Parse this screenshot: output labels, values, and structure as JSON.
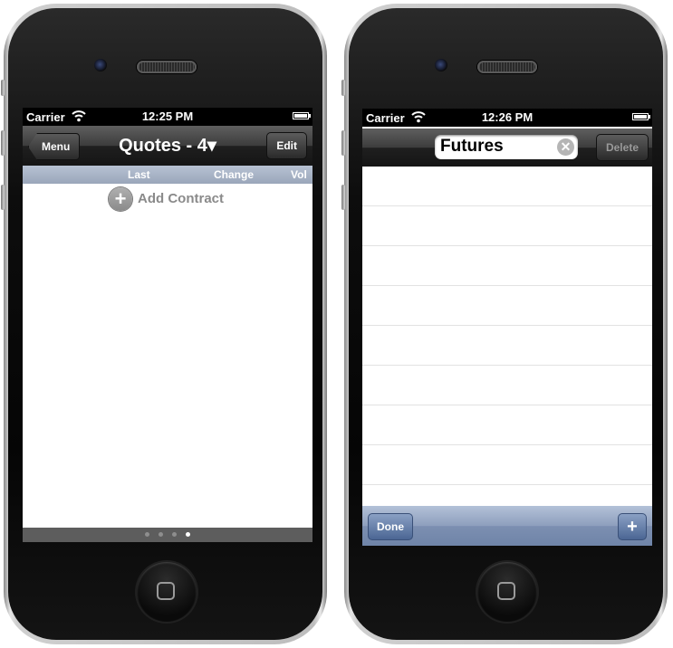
{
  "left_phone": {
    "status": {
      "carrier": "Carrier",
      "time": "12:25 PM"
    },
    "nav": {
      "back_label": "Menu",
      "title": "Quotes - 4▾",
      "edit_label": "Edit"
    },
    "columns": [
      "Last",
      "Change",
      "Vol"
    ],
    "add_contract": {
      "plus_glyph": "+",
      "label": "Add Contract"
    },
    "pages": {
      "count": 4,
      "active_index": 3
    }
  },
  "right_phone": {
    "status": {
      "carrier": "Carrier",
      "time": "12:26 PM"
    },
    "nav": {
      "field_value": "Futures",
      "clear_glyph": "✕",
      "delete_label": "Delete"
    },
    "list_rows": 9,
    "toolbar": {
      "done_label": "Done",
      "add_glyph": "+"
    }
  },
  "icons": [
    "wifi-icon",
    "battery-icon",
    "plus-circle-icon",
    "clear-icon",
    "add-icon",
    "camera-icon",
    "speaker-icon",
    "home-button-icon"
  ],
  "colors": {
    "navbar": "#2a2a2a",
    "column_header": "#a7b2c5",
    "toolbar": "#8ea0bf",
    "page_bar": "#5d5d5d"
  }
}
